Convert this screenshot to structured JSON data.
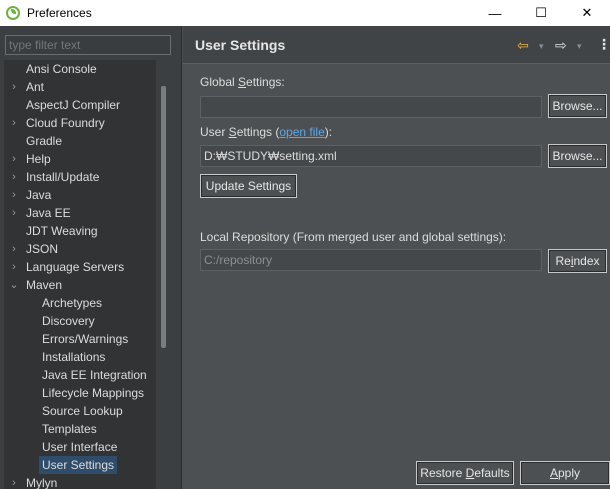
{
  "window": {
    "title": "Preferences",
    "controls": [
      "—",
      "☐",
      "✕"
    ]
  },
  "left": {
    "filter_placeholder": "type filter text",
    "tree": [
      {
        "label": "Ansi Console",
        "expander": "",
        "indent": 0
      },
      {
        "label": "Ant",
        "expander": "›",
        "indent": 0
      },
      {
        "label": "AspectJ Compiler",
        "expander": "",
        "indent": 0
      },
      {
        "label": "Cloud Foundry",
        "expander": "›",
        "indent": 0
      },
      {
        "label": "Gradle",
        "expander": "",
        "indent": 0
      },
      {
        "label": "Help",
        "expander": "›",
        "indent": 0
      },
      {
        "label": "Install/Update",
        "expander": "›",
        "indent": 0
      },
      {
        "label": "Java",
        "expander": "›",
        "indent": 0
      },
      {
        "label": "Java EE",
        "expander": "›",
        "indent": 0
      },
      {
        "label": "JDT Weaving",
        "expander": "",
        "indent": 0
      },
      {
        "label": "JSON",
        "expander": "›",
        "indent": 0
      },
      {
        "label": "Language Servers",
        "expander": "›",
        "indent": 0
      },
      {
        "label": "Maven",
        "expander": "⌄",
        "indent": 0
      },
      {
        "label": "Archetypes",
        "expander": "",
        "indent": 1
      },
      {
        "label": "Discovery",
        "expander": "",
        "indent": 1
      },
      {
        "label": "Errors/Warnings",
        "expander": "",
        "indent": 1
      },
      {
        "label": "Installations",
        "expander": "",
        "indent": 1
      },
      {
        "label": "Java EE Integration",
        "expander": "",
        "indent": 1
      },
      {
        "label": "Lifecycle Mappings",
        "expander": "",
        "indent": 1
      },
      {
        "label": "Source Lookup",
        "expander": "",
        "indent": 1
      },
      {
        "label": "Templates",
        "expander": "",
        "indent": 1
      },
      {
        "label": "User Interface",
        "expander": "",
        "indent": 1
      },
      {
        "label": "User Settings",
        "expander": "",
        "indent": 1,
        "selected": true
      },
      {
        "label": "Mylyn",
        "expander": "›",
        "indent": 0
      }
    ]
  },
  "main": {
    "title": "User Settings",
    "nav": {
      "back_icon": "⇦",
      "forward_icon": "⇨",
      "dropdown_icon": "▾",
      "menu_icon": "⋮"
    },
    "global_settings": {
      "label_pre": "Global ",
      "label_u": "S",
      "label_post": "ettings:",
      "value": "",
      "browse": "Browse..."
    },
    "user_settings": {
      "label_pre": "User ",
      "label_u": "S",
      "label_post": "ettings (",
      "link": "open file",
      "label_end": "):",
      "value": "D:₩STUDY₩setting.xml",
      "browse": "Browse..."
    },
    "update_button": "Update Settings",
    "local_repo": {
      "label": "Local Repository (From merged user and global settings):",
      "value": "C:/repository",
      "reindex_pre": "Re",
      "reindex_u": "i",
      "reindex_post": "ndex"
    },
    "restore_pre": "Restore ",
    "restore_u": "D",
    "restore_post": "efaults",
    "apply_u": "A",
    "apply_post": "pply"
  },
  "colors": {
    "accent_link": "#5aa7e6",
    "back_arrow": "#f0b43c",
    "selection": "#2f4d6b"
  }
}
